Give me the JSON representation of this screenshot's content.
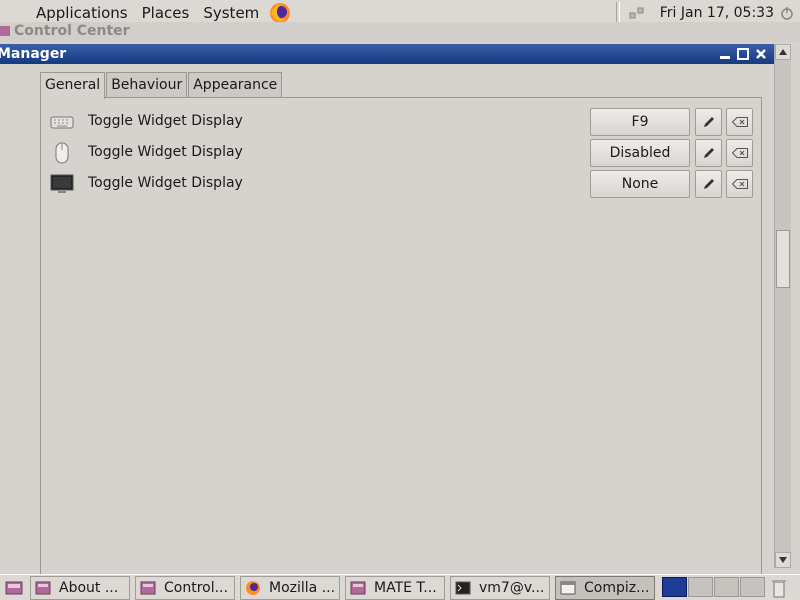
{
  "top_panel": {
    "menus": [
      "Applications",
      "Places",
      "System"
    ],
    "clock": "Fri Jan 17, 05:33",
    "icons": [
      "firefox-icon",
      "network-icon",
      "power-icon"
    ]
  },
  "background_window": {
    "title": "Control Center"
  },
  "window": {
    "title": "Manager",
    "controls": [
      "minimize",
      "maximize",
      "close"
    ]
  },
  "tabs": [
    {
      "label": "General",
      "active": true
    },
    {
      "label": "Behaviour",
      "active": false
    },
    {
      "label": "Appearance",
      "active": false
    }
  ],
  "bindings": [
    {
      "icon": "keyboard-icon",
      "label": "Toggle Widget Display",
      "value": "F9"
    },
    {
      "icon": "mouse-icon",
      "label": "Toggle Widget Display",
      "value": "Disabled"
    },
    {
      "icon": "screen-edge-icon",
      "label": "Toggle Widget Display",
      "value": "None"
    }
  ],
  "taskbar": {
    "tasks": [
      {
        "label": "About ...",
        "icon": "app-icon",
        "active": false
      },
      {
        "label": "Control...",
        "icon": "app-icon",
        "active": false
      },
      {
        "label": "Mozilla ...",
        "icon": "firefox-icon",
        "active": false
      },
      {
        "label": "MATE T...",
        "icon": "app-icon",
        "active": false
      },
      {
        "label": "vm7@v...",
        "icon": "terminal-icon",
        "active": false
      },
      {
        "label": "Compiz...",
        "icon": "window-icon",
        "active": true
      }
    ],
    "workspaces": 4,
    "active_workspace": 1
  },
  "colors": {
    "titlebar": "#1e4690",
    "workspace_active": "#1e3c96",
    "panel_bg": "#dcd9d4"
  }
}
